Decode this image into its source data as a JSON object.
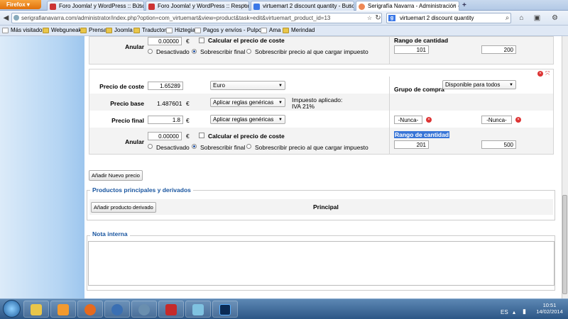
{
  "browser": {
    "app_button": "Firefox",
    "tabs": [
      {
        "label": "Foro Joomla! y WordPress :: Búsqued...",
        "active": false
      },
      {
        "label": "Foro Joomla! y WordPress :: Respond...",
        "active": false
      },
      {
        "label": "virtuemart 2 discount quantity - Busc...",
        "active": false
      },
      {
        "label": "Serigrafía Navarra - Administración - ...",
        "active": true
      }
    ],
    "new_tab": "+",
    "url": "serigrafianavarra.com/administrator/index.php?option=com_virtuemart&view=product&task=edit&virtuemart_product_id=13",
    "search_value": "virtuemart 2 discount quantity",
    "bookmarks": [
      "Más visitados",
      "Webguneak",
      "Prensa",
      "Joomla",
      "Traductor",
      "Hiztegia",
      "Pagos y envíos - Pulpo...",
      "Ama",
      "Merindad"
    ]
  },
  "top_price_row": {
    "label": "Anular",
    "value": "0.00000",
    "currency": "€",
    "calc_cost": "Calcular el precio de coste",
    "opt_disabled": "Desactivado",
    "opt_overwrite": "Sobrescribir final",
    "opt_overwrite_tax": "Sobrescribir precio al que cargar impuesto",
    "range_title": "Rango de cantidad",
    "range_from": "101",
    "range_to": "200"
  },
  "price_block": {
    "cost_label": "Precio de coste",
    "cost_value": "1.65289",
    "currency_select": "Euro",
    "buy_group_label": "Grupo de compra",
    "buy_group_select": "Disponible para todos",
    "base_label": "Precio base",
    "base_value": "1.487601",
    "currency": "€",
    "rules_select": "Aplicar reglas genéricas",
    "tax_label": "Impuesto aplicado:",
    "tax_value": "IVA 21%",
    "final_label": "Precio final",
    "final_value": "1.8",
    "rules_select_2": "Aplicar reglas genéricas",
    "never_1": "-Nunca-",
    "never_2": "-Nunca-",
    "override_label": "Anular",
    "override_value": "0.00000",
    "calc_cost": "Calcular el precio de coste",
    "opt_disabled": "Desactivado",
    "opt_overwrite": "Sobrescribir final",
    "opt_overwrite_tax": "Sobrescribir precio al que cargar impuesto",
    "range_title": "Rango de cantidad",
    "range_from": "201",
    "range_to": "500"
  },
  "add_price_button": "Añadir Nuevo precio",
  "related": {
    "legend": "Productos principales y derivados",
    "add_button": "Añadir producto derivado",
    "column": "Principal"
  },
  "notes": {
    "legend": "Nota interna",
    "value": ""
  },
  "taskbar": {
    "lang": "ES",
    "time": "10:51",
    "date": "14/02/2014"
  }
}
